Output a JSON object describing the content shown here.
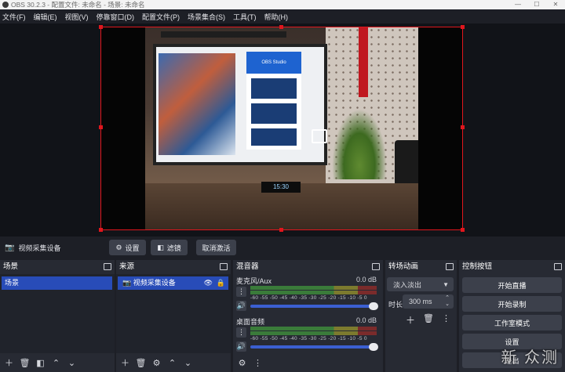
{
  "titlebar": {
    "title": "OBS 30.2.3 - 配置文件: 未命名 - 场景: 未命名",
    "minimize": "—",
    "maximize": "☐",
    "close": "✕"
  },
  "menu": [
    "文件(F)",
    "编辑(E)",
    "视图(V)",
    "停靠窗口(D)",
    "配置文件(P)",
    "场景集合(S)",
    "工具(T)",
    "帮助(H)"
  ],
  "source_bar": {
    "source_name": "视频采集设备",
    "settings_label": "设置",
    "filters_label": "滤镜",
    "deactivate_label": "取消激活"
  },
  "scenes": {
    "title": "场景",
    "items": [
      "场景"
    ]
  },
  "sources": {
    "title": "来源",
    "items": [
      "视频采集设备"
    ]
  },
  "mixer": {
    "title": "混音器",
    "ticks": "-60 -55 -50 -45 -40 -35 -30 -25 -20 -15 -10 -5 0",
    "tracks": [
      {
        "name": "麦克风/Aux",
        "db": "0.0 dB",
        "volume": 1.0
      },
      {
        "name": "桌面音频",
        "db": "0.0 dB",
        "volume": 1.0
      }
    ]
  },
  "transitions": {
    "title": "转场动画",
    "type": "淡入淡出",
    "duration_label": "时长",
    "duration_value": "300 ms"
  },
  "controls": {
    "title": "控制按钮",
    "buttons": [
      "开始直播",
      "开始录制",
      "工作室模式",
      "设置",
      "退出"
    ]
  },
  "monitor_screen": {
    "title": "OBS Studio"
  },
  "clock_display": "15:30",
  "watermark": "新 众测",
  "colors": {
    "selection": "#284cb8",
    "bounding_box": "#e0161d",
    "panel": "#272a33",
    "background": "#1d1f26"
  }
}
